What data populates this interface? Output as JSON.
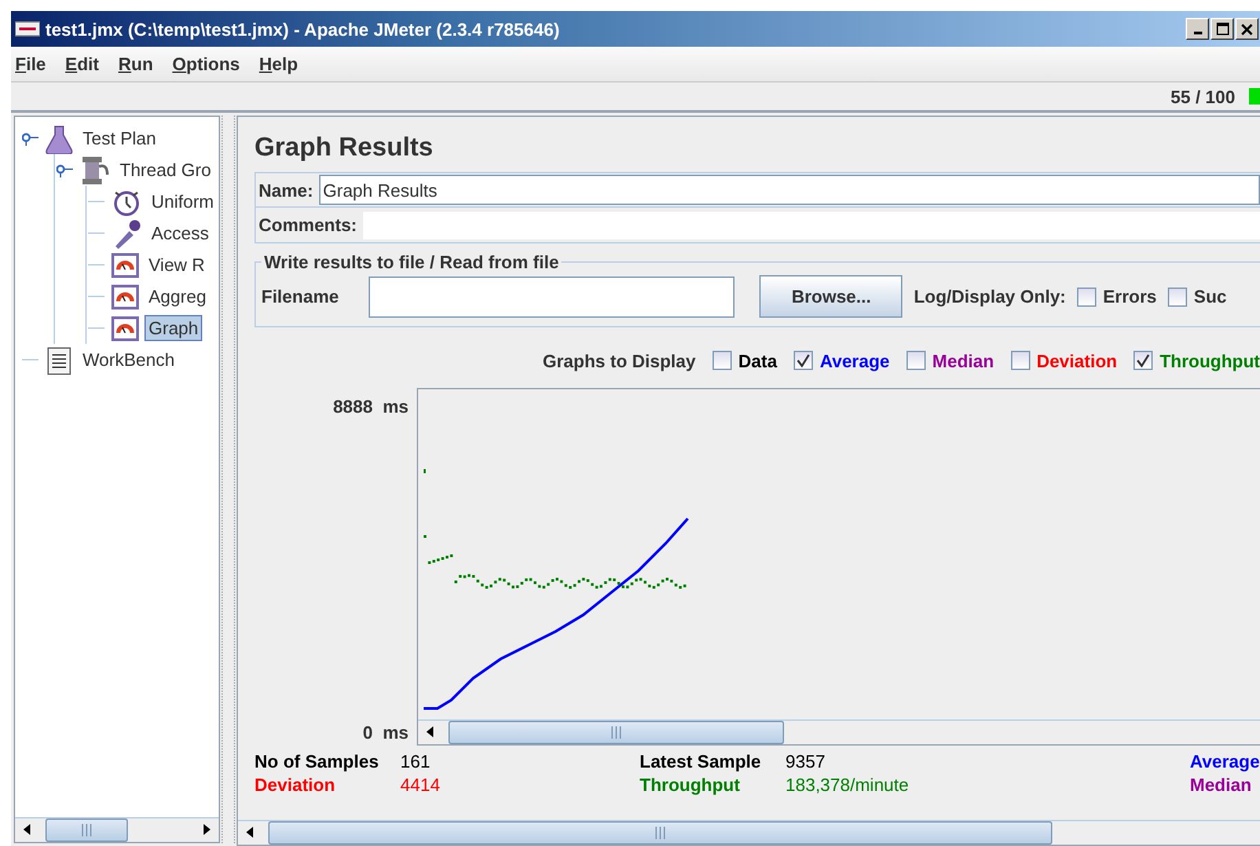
{
  "window": {
    "title": "test1.jmx (C:\\temp\\test1.jmx) - Apache JMeter (2.3.4 r785646)"
  },
  "menu": [
    {
      "label": "File"
    },
    {
      "label": "Edit"
    },
    {
      "label": "Run"
    },
    {
      "label": "Options"
    },
    {
      "label": "Help"
    }
  ],
  "toolbar": {
    "threads": "55 / 100"
  },
  "tree": [
    {
      "label": "Test Plan",
      "kind": "plan",
      "selected": false,
      "children": [
        {
          "label": "Thread Gro",
          "kind": "threads",
          "selected": false,
          "children": [
            {
              "label": "Uniform",
              "kind": "timer",
              "selected": false
            },
            {
              "label": "Access",
              "kind": "sampler",
              "selected": false
            },
            {
              "label": "View R",
              "kind": "listener",
              "selected": false
            },
            {
              "label": "Aggreg",
              "kind": "listener",
              "selected": false
            },
            {
              "label": "Graph",
              "kind": "listener",
              "selected": true
            }
          ]
        }
      ]
    },
    {
      "label": "WorkBench",
      "kind": "workbench",
      "selected": false
    }
  ],
  "panel": {
    "title": "Graph Results",
    "name_label": "Name:",
    "name": "Graph Results",
    "comments_label": "Comments:",
    "file_group": {
      "legend": "Write results to file / Read from file",
      "filename_label": "Filename",
      "browse": "Browse...",
      "log_label": "Log/Display Only:",
      "options": [
        {
          "label": "Errors",
          "checked": false
        },
        {
          "label": "Suc",
          "checked": false
        }
      ]
    },
    "graphs_label": "Graphs to Display",
    "graphs": [
      {
        "label": "Data",
        "checked": false,
        "color": "#000000"
      },
      {
        "label": "Average",
        "checked": true,
        "color": "#0000ff"
      },
      {
        "label": "Median",
        "checked": false,
        "color": "#990099"
      },
      {
        "label": "Deviation",
        "checked": false,
        "color": "#ff0000"
      },
      {
        "label": "Throughput",
        "checked": true,
        "color": "#008000"
      }
    ],
    "y_top": "8888  ms",
    "y_bottom": "0  ms",
    "stats": [
      {
        "label": "No of Samples",
        "value": "161",
        "color": "#000000"
      },
      {
        "label": "Latest Sample",
        "value": "9357",
        "color": "#000000"
      },
      {
        "label": "Average",
        "color": "#0000ff"
      },
      {
        "label": "Deviation",
        "value": "4414",
        "color": "#ff0000"
      },
      {
        "label": "Throughput",
        "value": "183,378/minute",
        "color": "#008000"
      },
      {
        "label": "Median",
        "color": "#990099"
      }
    ]
  }
}
